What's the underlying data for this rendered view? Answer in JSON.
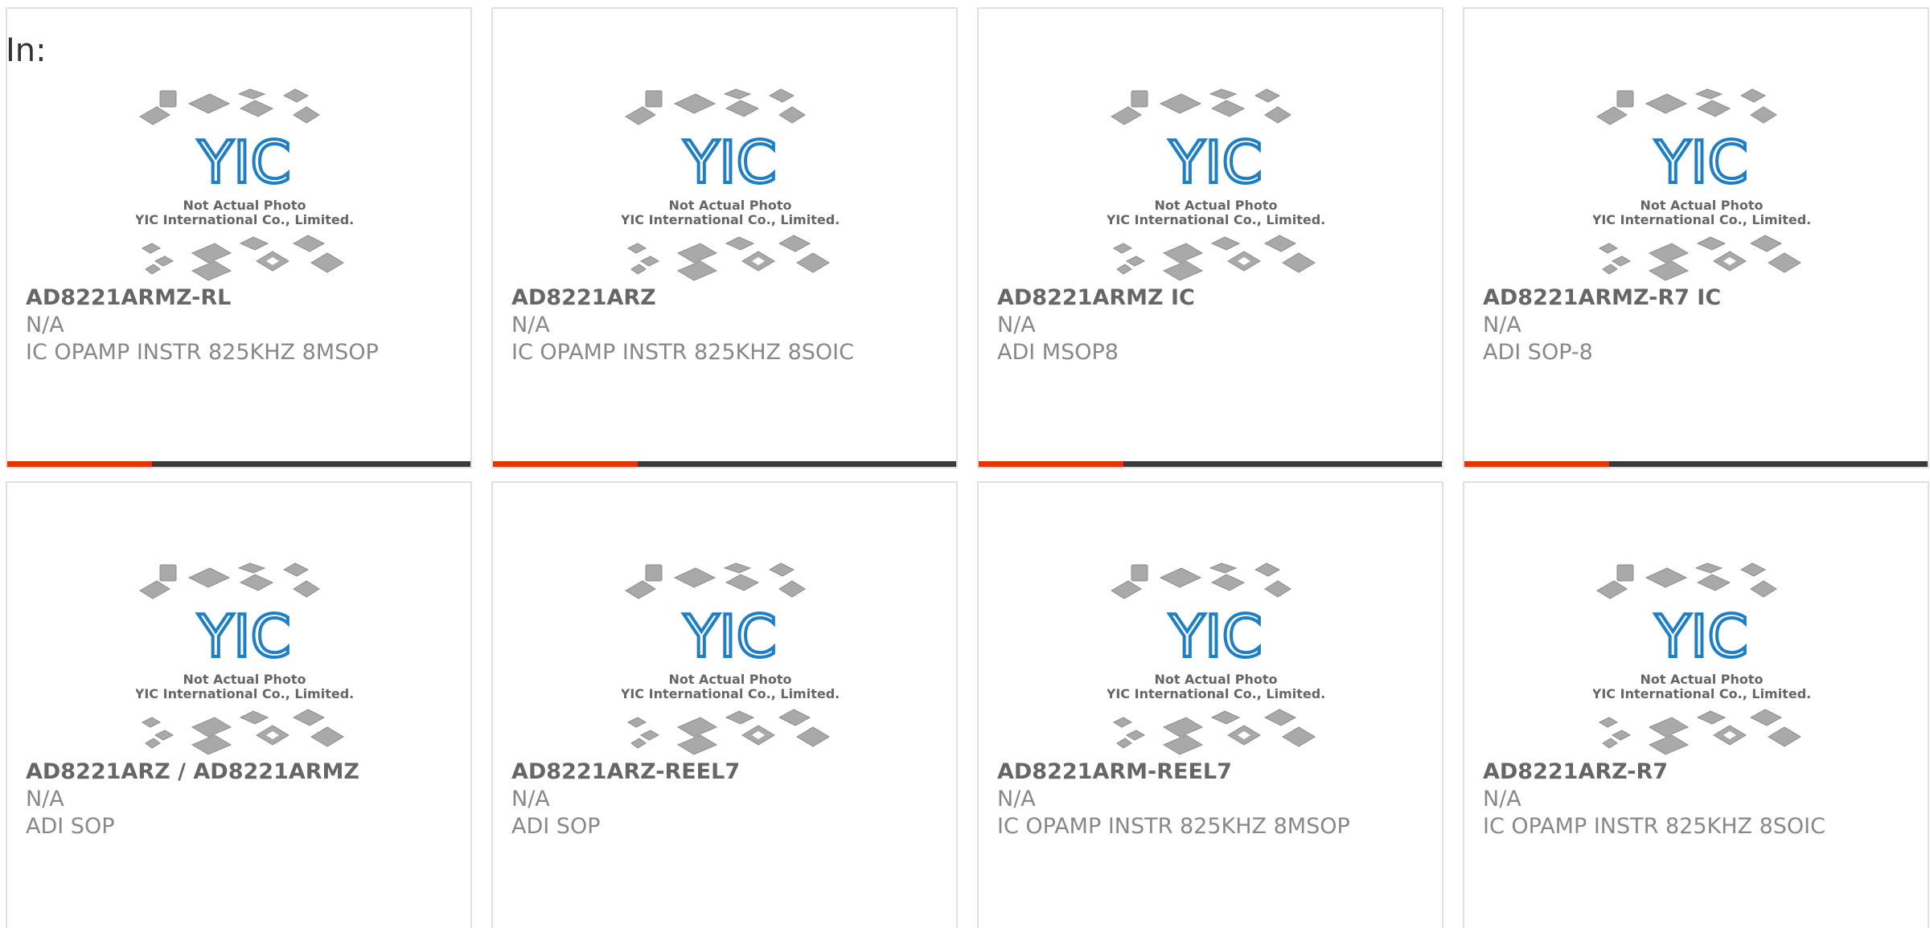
{
  "heading": "In:",
  "placeholder": {
    "logo_text": "YIC",
    "caption_line1": "Not Actual Photo",
    "caption_line2": "YIC International Co., Limited."
  },
  "colors": {
    "accent": "#e8320c",
    "bar": "#3a3a3a",
    "logo_blue": "#1f7fc4"
  },
  "products": [
    {
      "part": "AD8221ARMZ-RL",
      "stock": "N/A",
      "desc": "IC OPAMP INSTR 825KHZ 8MSOP"
    },
    {
      "part": "AD8221ARZ",
      "stock": "N/A",
      "desc": "IC OPAMP INSTR 825KHZ 8SOIC"
    },
    {
      "part": "AD8221ARMZ IC",
      "stock": "N/A",
      "desc": "ADI MSOP8"
    },
    {
      "part": "AD8221ARMZ-R7 IC",
      "stock": "N/A",
      "desc": "ADI SOP-8"
    },
    {
      "part": "AD8221ARZ / AD8221ARMZ",
      "stock": "N/A",
      "desc": "ADI SOP"
    },
    {
      "part": "AD8221ARZ-REEL7",
      "stock": "N/A",
      "desc": "ADI SOP"
    },
    {
      "part": "AD8221ARM-REEL7",
      "stock": "N/A",
      "desc": "IC OPAMP INSTR 825KHZ 8MSOP"
    },
    {
      "part": "AD8221ARZ-R7",
      "stock": "N/A",
      "desc": "IC OPAMP INSTR 825KHZ 8SOIC"
    }
  ]
}
